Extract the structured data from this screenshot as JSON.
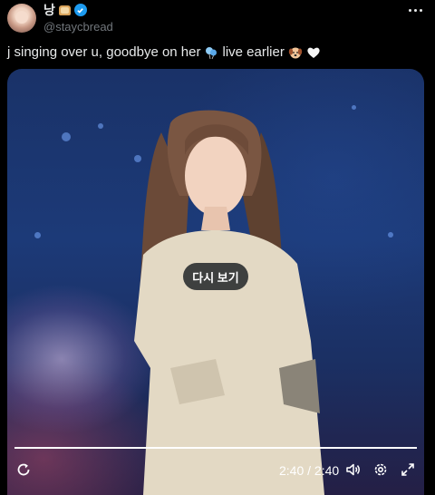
{
  "header": {
    "display_name": "낭",
    "handle": "@staycbread"
  },
  "icons": {
    "avatar": "avatar-image",
    "bread": "bread-emoji-icon",
    "verified": "verified-badge-icon",
    "more": "more-options-icon",
    "balloons": "balloons-emoji-icon",
    "puppy": "dog-face-emoji-icon",
    "heart": "white-heart-emoji-icon",
    "replay": "replay-icon",
    "volume": "volume-icon",
    "settings": "gear-icon",
    "fullscreen": "fullscreen-icon"
  },
  "tweet": {
    "text_part1": "j singing over u, goodbye on her",
    "text_part2": "live earlier"
  },
  "video": {
    "replay_label": "다시 보기",
    "time": "2:40 / 2:40",
    "progress": 1.0
  },
  "colors": {
    "background": "#000000",
    "text": "#e7e9ea",
    "handle": "#71767b",
    "verified": "#1d9bf0"
  }
}
